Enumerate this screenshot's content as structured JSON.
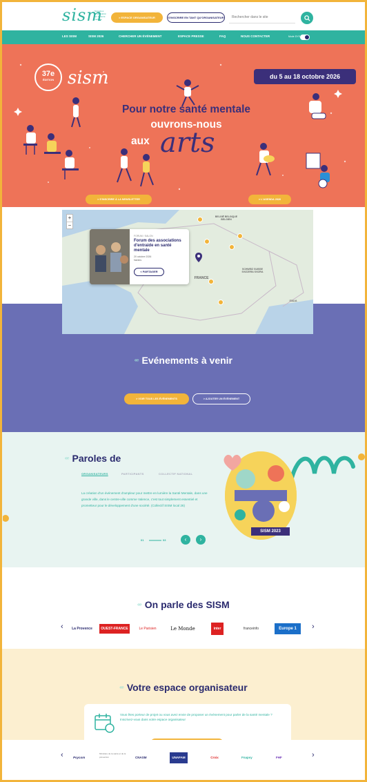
{
  "header": {
    "logo_text": "sism",
    "logo_subtitle": "Semaines d'information sur la santé mentale",
    "btn_organisateur": "> ESPACE ORGANISATEUR",
    "btn_participer": "S'INSCRIRE EN TANT QU'ORGANISATEUR",
    "search_placeholder": "Rechercher dans le site"
  },
  "nav": {
    "items": [
      "LES SISM",
      "SISM 2026",
      "CHERCHER UN ÉVÉNEMENT",
      "ESPACE PRESSE",
      "FAQ",
      "NOUS CONTACTER"
    ],
    "toggle_label": "Mode DYS"
  },
  "hero": {
    "badge_num": "37e",
    "badge_text": "ÉDITION",
    "logo_text": "sism",
    "dates": "du 5 au 18 octobre 2026",
    "line1": "Pour notre santé mentale",
    "line2": "ouvrons-nous",
    "line3": "aux",
    "line4": "arts",
    "btn_left": "> S'INSCRIRE À LA NEWSLETTER",
    "btn_right": "> L'AGENDA 2026",
    "colors": {
      "bg": "#ee7358",
      "accent": "#3b2f7a"
    }
  },
  "map": {
    "labels": [
      "BELGIË BELGIQUE BELGIEN",
      "FRANCE",
      "SCHWEIZ SUISSE SVIZZERA SVIZRA",
      "ITALIA"
    ],
    "popup": {
      "category": "FORUM / SALON",
      "title": "Forum des associations d'entraide en santé mentale",
      "date": "20 octobre 2026",
      "place": "Nantes",
      "share": "< PARTAGER"
    }
  },
  "events": {
    "title": "Evénements à venir",
    "btn_all": "> VOIR TOUS LES ÉVÉNEMENTS",
    "btn_add": "> AJOUTER UN ÉVÉNEMENT"
  },
  "testimonials": {
    "title": "Paroles de",
    "tabs": [
      "ORGANISATEURS",
      "PARTICIPANTS",
      "COLLECTIF NATIONAL"
    ],
    "quote": "La création d'un événement d'ampleur pour mettre en lumière la Santé Mentale, dans une grande ville, dans le centre-ville comme Valence, c'est tout simplement essentiel et prometteur pour le développement d'une société. (Collectif SISM local 26)",
    "pager_current": "01",
    "pager_total": "03",
    "poster_label": "SISM 2023"
  },
  "press": {
    "title": "On parle des SISM",
    "logos": [
      "La Provence",
      "OUEST-FRANCE",
      "Le Parisien",
      "Le Monde",
      "inter",
      "franceinfo",
      "Europe 1"
    ]
  },
  "organizer": {
    "title": "Votre espace organisateur",
    "text": "Vous êtes porteur de projet ou vous avez envie de proposer un événement pour parler de la santé mentale ? Inscrivez-vous dans votre espace organisateur",
    "btn": "ACCÉDER À L'ESPACE ORGANISATEUR"
  },
  "partners": {
    "logos": [
      "Psycom",
      "Ministère de la santé et de la prévention",
      "CNASM",
      "UNAFAM",
      "Croix",
      "Fnapsy",
      "FHF"
    ]
  }
}
